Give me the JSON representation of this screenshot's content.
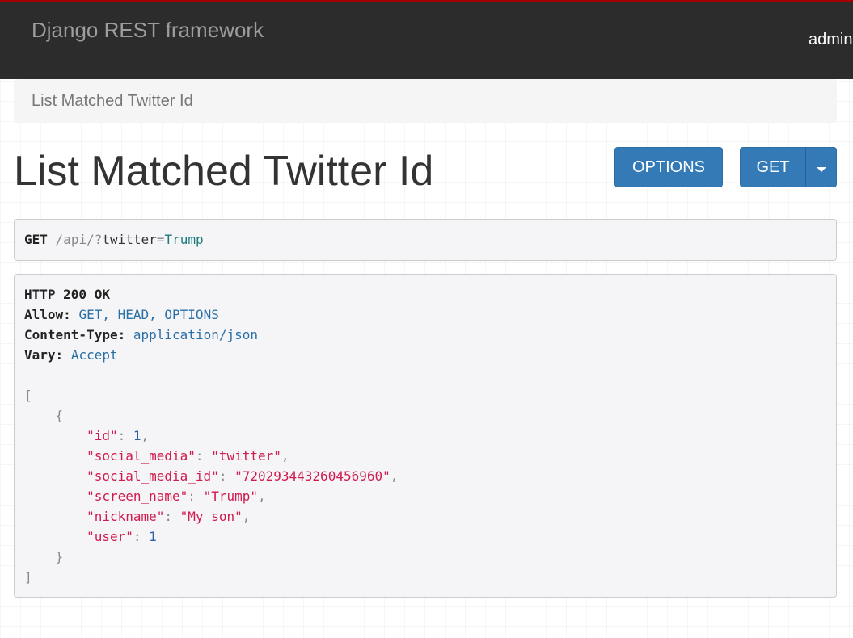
{
  "navbar": {
    "brand": "Django REST framework",
    "user": "admin"
  },
  "breadcrumb": {
    "current": "List Matched Twitter Id"
  },
  "page": {
    "title": "List Matched Twitter Id",
    "options_label": "OPTIONS",
    "get_label": "GET"
  },
  "request": {
    "method": "GET",
    "path": "/api/",
    "query_prefix": "?",
    "query_key": "twitter",
    "query_eq": "=",
    "query_value": "Trump"
  },
  "response": {
    "status": "HTTP 200 OK",
    "headers": [
      {
        "name": "Allow:",
        "value": "GET, HEAD, OPTIONS"
      },
      {
        "name": "Content-Type:",
        "value": "application/json"
      },
      {
        "name": "Vary:",
        "value": "Accept"
      }
    ],
    "body": {
      "open_bracket": "[",
      "open_brace": "{",
      "fields": [
        {
          "key": "\"id\"",
          "value": "1",
          "type": "num",
          "comma": ","
        },
        {
          "key": "\"social_media\"",
          "value": "\"twitter\"",
          "type": "str",
          "comma": ","
        },
        {
          "key": "\"social_media_id\"",
          "value": "\"720293443260456960\"",
          "type": "str",
          "comma": ","
        },
        {
          "key": "\"screen_name\"",
          "value": "\"Trump\"",
          "type": "str",
          "comma": ","
        },
        {
          "key": "\"nickname\"",
          "value": "\"My son\"",
          "type": "str",
          "comma": ","
        },
        {
          "key": "\"user\"",
          "value": "1",
          "type": "num",
          "comma": ""
        }
      ],
      "close_brace": "}",
      "close_bracket": "]"
    }
  },
  "colors": {
    "navbar_bg": "#2c2c2c",
    "navbar_accent": "#a30000",
    "button_primary": "#337ab7",
    "json_string": "#d01b4d",
    "json_number": "#2a5fa5",
    "header_value": "#2a6fa5"
  }
}
